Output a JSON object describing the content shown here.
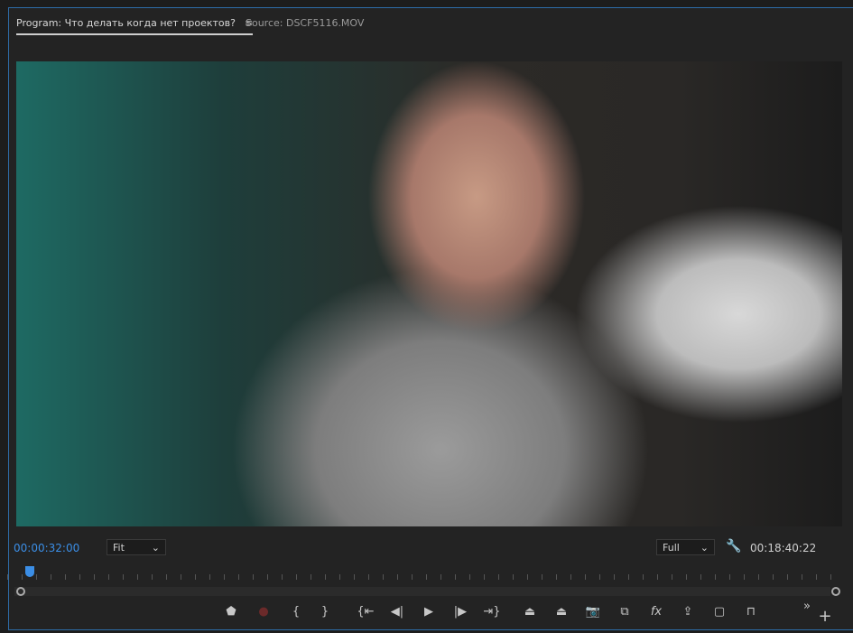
{
  "tabs": [
    {
      "label": "Program: Что делать когда нет проектов?",
      "active": true
    },
    {
      "label": "Source: DSCF5116.MOV",
      "active": false
    }
  ],
  "menu_icon": "≡",
  "current_timecode": "00:00:32:00",
  "duration_timecode": "00:18:40:22",
  "zoom_select": "Fit",
  "resolution_select": "Full",
  "playhead_position_fraction": 0.029,
  "accent_color": "#3b8ee6",
  "controls": [
    {
      "name": "add-marker",
      "glyph": "⬟"
    },
    {
      "name": "record",
      "glyph": "●"
    },
    {
      "name": "mark-in",
      "glyph": "{"
    },
    {
      "name": "mark-out",
      "glyph": "}"
    },
    {
      "name": "go-to-in",
      "glyph": "{⇤"
    },
    {
      "name": "step-back",
      "glyph": "◀|"
    },
    {
      "name": "play",
      "glyph": "▶"
    },
    {
      "name": "step-forward",
      "glyph": "|▶"
    },
    {
      "name": "go-to-out",
      "glyph": "⇥}"
    },
    {
      "name": "lift",
      "glyph": "⏏"
    },
    {
      "name": "extract",
      "glyph": "⏏"
    },
    {
      "name": "export-frame",
      "glyph": "📷"
    },
    {
      "name": "comparison-view",
      "glyph": "⧉"
    },
    {
      "name": "fx",
      "glyph": "fx"
    },
    {
      "name": "export",
      "glyph": "⇪"
    },
    {
      "name": "safe-margins",
      "glyph": "▢"
    },
    {
      "name": "timeline-ruler",
      "glyph": "⊓"
    },
    {
      "name": "more",
      "glyph": "»"
    },
    {
      "name": "button-editor",
      "glyph": "+"
    }
  ]
}
